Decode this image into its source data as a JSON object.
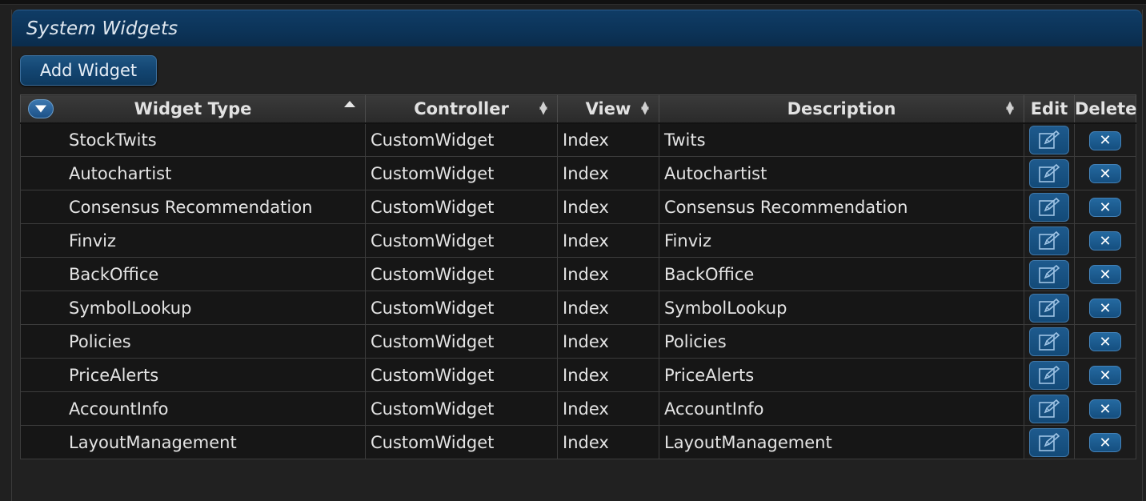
{
  "panel": {
    "title": "System Widgets",
    "add_button_label": "Add Widget"
  },
  "grid": {
    "columns": {
      "widget_type": "Widget Type",
      "controller": "Controller",
      "view": "View",
      "description": "Description",
      "edit": "Edit",
      "delete": "Delete"
    },
    "rows": [
      {
        "widget_type": "StockTwits",
        "controller": "CustomWidget",
        "view": "Index",
        "description": "Twits"
      },
      {
        "widget_type": "Autochartist",
        "controller": "CustomWidget",
        "view": "Index",
        "description": "Autochartist"
      },
      {
        "widget_type": "Consensus Recommendation",
        "controller": "CustomWidget",
        "view": "Index",
        "description": "Consensus Recommendation"
      },
      {
        "widget_type": "Finviz",
        "controller": "CustomWidget",
        "view": "Index",
        "description": "Finviz"
      },
      {
        "widget_type": "BackOffice",
        "controller": "CustomWidget",
        "view": "Index",
        "description": "BackOffice"
      },
      {
        "widget_type": "SymbolLookup",
        "controller": "CustomWidget",
        "view": "Index",
        "description": "SymbolLookup"
      },
      {
        "widget_type": "Policies",
        "controller": "CustomWidget",
        "view": "Index",
        "description": "Policies"
      },
      {
        "widget_type": "PriceAlerts",
        "controller": "CustomWidget",
        "view": "Index",
        "description": "PriceAlerts"
      },
      {
        "widget_type": "AccountInfo",
        "controller": "CustomWidget",
        "view": "Index",
        "description": "AccountInfo"
      },
      {
        "widget_type": "LayoutManagement",
        "controller": "CustomWidget",
        "view": "Index",
        "description": "LayoutManagement"
      }
    ]
  },
  "icons": {
    "filter": "filter-icon",
    "sort": "sort-icon",
    "edit": "edit-icon",
    "delete": "delete-icon"
  },
  "colors": {
    "header_blue": "#0c3459",
    "button_blue": "#134571",
    "row_bg": "#161616"
  }
}
